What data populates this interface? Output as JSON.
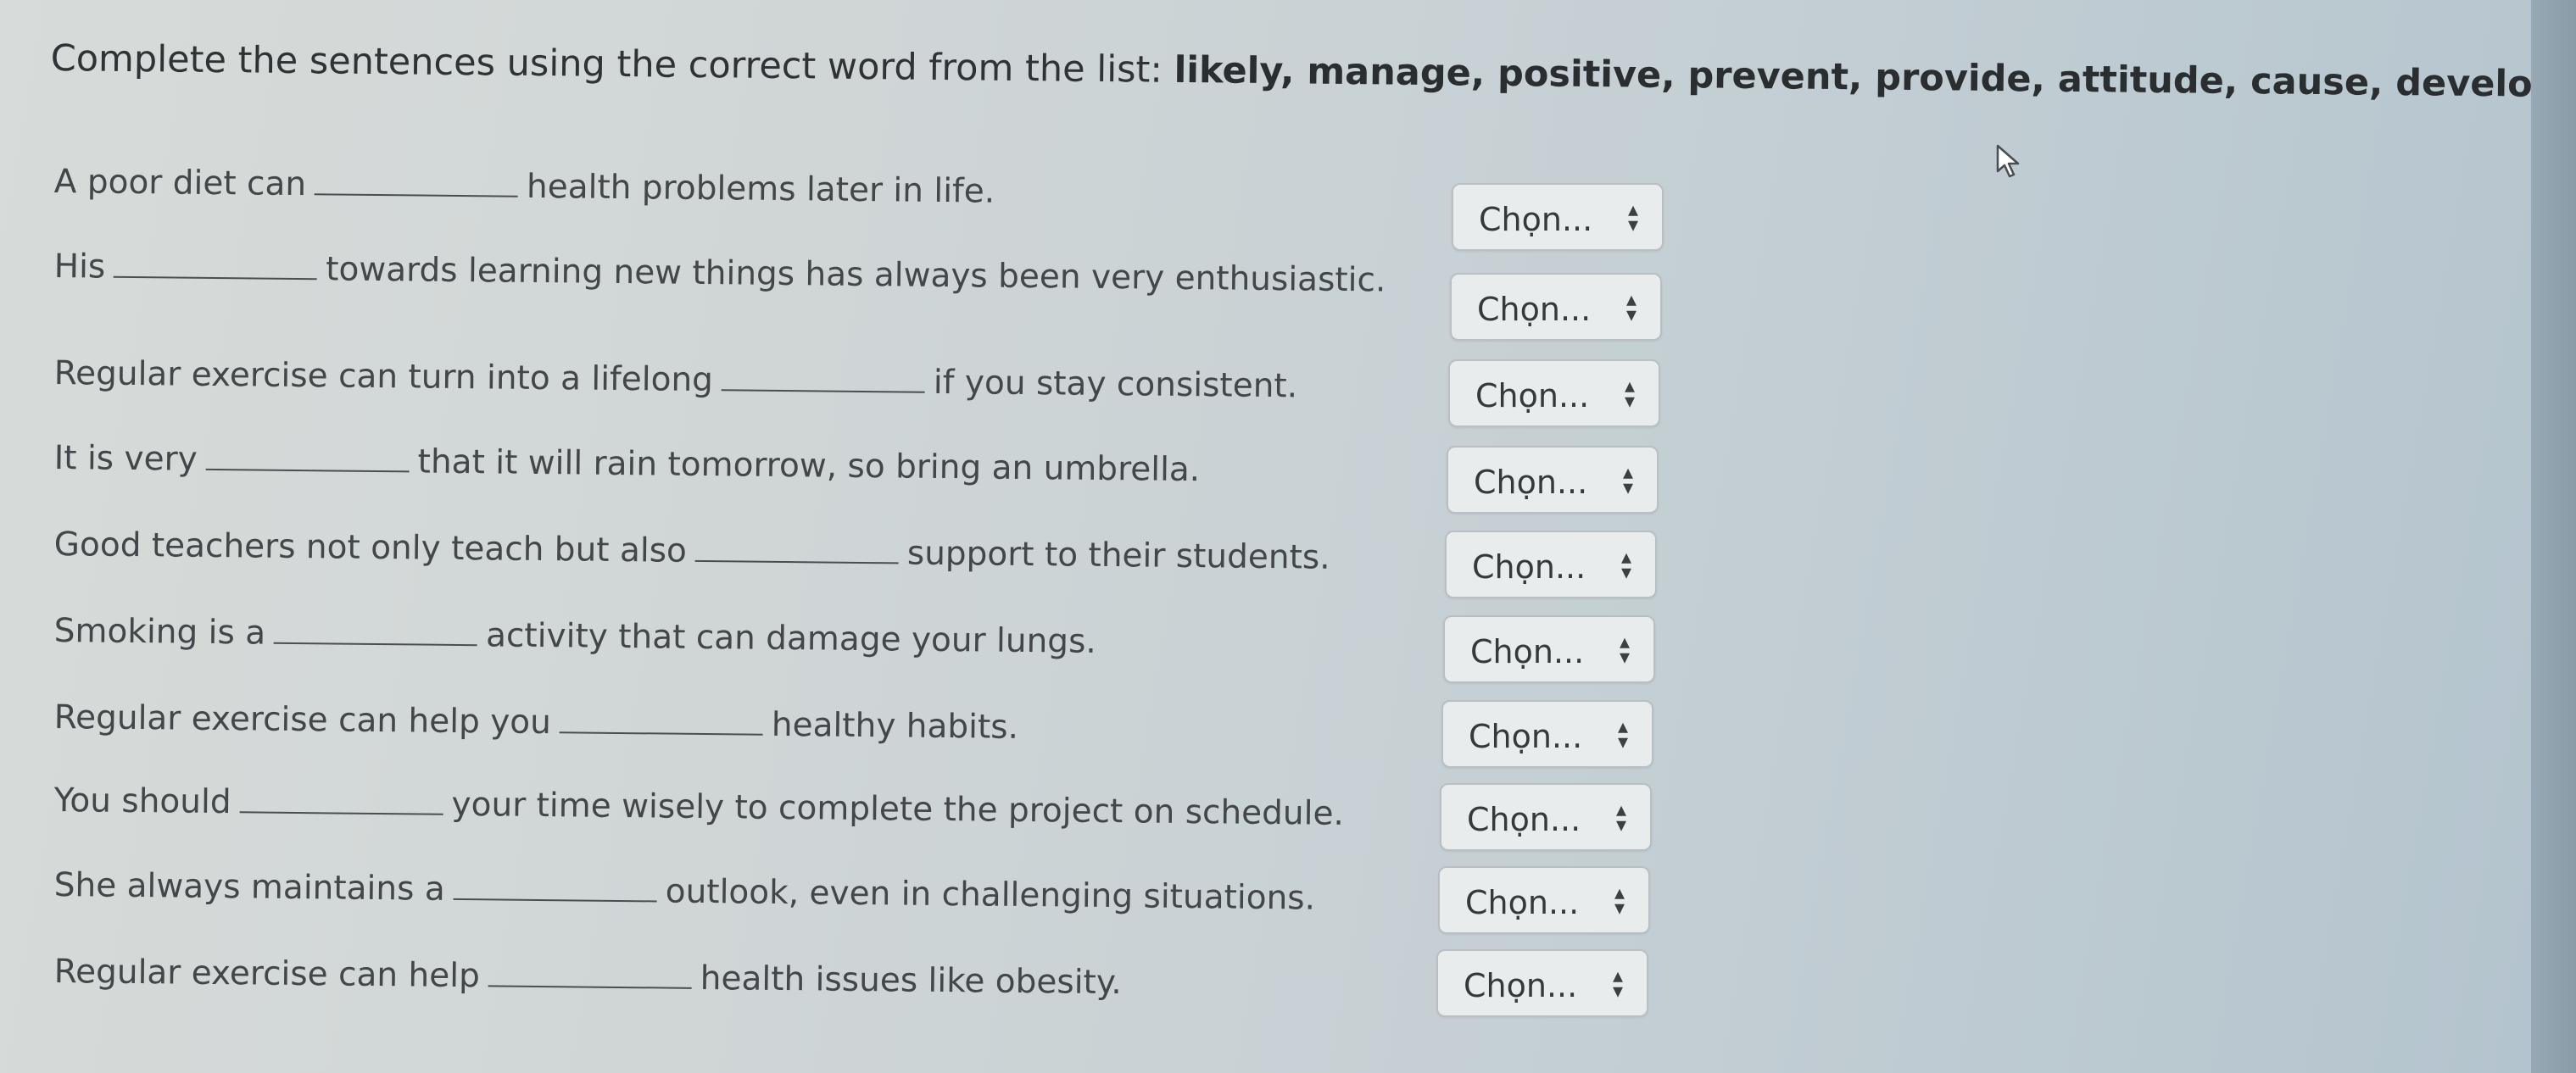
{
  "instruction": {
    "prefix": "Complete the sentences using the correct word from the list: ",
    "words": "likely, manage, positive, prevent, provide, attitude, cause, develop, habit, harmful."
  },
  "questions": [
    {
      "before": "A poor diet can",
      "after": "health problems later in life.",
      "select": "Chọn..."
    },
    {
      "before": "His",
      "after": "towards learning new things has always been very enthusiastic.",
      "select": "Chọn..."
    },
    {
      "before": "Regular exercise can turn into a lifelong",
      "after": "if you stay consistent.",
      "select": "Chọn..."
    },
    {
      "before": "It is very",
      "after": "that it will rain tomorrow, so bring an umbrella.",
      "select": "Chọn..."
    },
    {
      "before": "Good teachers not only teach but also",
      "after": "support to their students.",
      "select": "Chọn..."
    },
    {
      "before": "Smoking is a",
      "after": "activity that can damage your lungs.",
      "select": "Chọn..."
    },
    {
      "before": "Regular exercise can help you",
      "after": "healthy habits.",
      "select": "Chọn..."
    },
    {
      "before": "You should",
      "after": "your time wisely to complete the project on schedule.",
      "select": "Chọn..."
    },
    {
      "before": "She always maintains a",
      "after": "outlook, even in challenging situations.",
      "select": "Chọn..."
    },
    {
      "before": "Regular exercise can help",
      "after": "health issues like obesity.",
      "select": "Chọn..."
    }
  ],
  "icons": {
    "select_arrow": "up-down-chevron-icon",
    "cursor": "mouse-pointer-icon"
  }
}
